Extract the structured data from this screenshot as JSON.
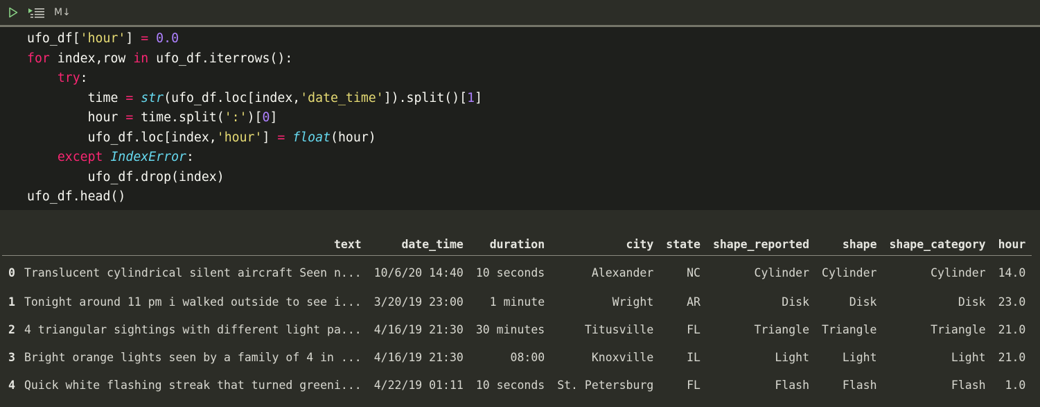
{
  "toolbar": {
    "run_icon": "play-icon",
    "run_below_icon": "run-below-icon",
    "markdown_label": "M↓"
  },
  "code": {
    "lines": [
      "ufo_df['hour'] = 0.0",
      "for index,row in ufo_df.iterrows():",
      "    try:",
      "        time = str(ufo_df.loc[index,'date_time']).split()[1]",
      "        hour = time.split(':')[0]",
      "        ufo_df.loc[index,'hour'] = float(hour)",
      "    except IndexError:",
      "        ufo_df.drop(index)",
      "ufo_df.head()"
    ]
  },
  "colors": {
    "keyword": "#f92672",
    "string": "#e6db74",
    "number": "#ae81ff",
    "builtin": "#66d9ef",
    "code_bg": "#1e1f1c",
    "output_bg": "#2c2d27"
  },
  "output": {
    "columns": [
      "",
      "text",
      "date_time",
      "duration",
      "city",
      "state",
      "shape_reported",
      "shape",
      "shape_category",
      "hour"
    ],
    "rows": [
      [
        "0",
        "Translucent cylindrical silent aircraft Seen n...",
        "10/6/20 14:40",
        "10 seconds",
        "Alexander",
        "NC",
        "Cylinder",
        "Cylinder",
        "Cylinder",
        "14.0"
      ],
      [
        "1",
        "Tonight around 11 pm i walked outside to see i...",
        "3/20/19 23:00",
        "1 minute",
        "Wright",
        "AR",
        "Disk",
        "Disk",
        "Disk",
        "23.0"
      ],
      [
        "2",
        "4 triangular sightings with different light pa...",
        "4/16/19 21:30",
        "30 minutes",
        "Titusville",
        "FL",
        "Triangle",
        "Triangle",
        "Triangle",
        "21.0"
      ],
      [
        "3",
        "Bright orange lights seen by a family of 4 in ...",
        "4/16/19 21:30",
        "08:00",
        "Knoxville",
        "IL",
        "Light",
        "Light",
        "Light",
        "21.0"
      ],
      [
        "4",
        "Quick white flashing streak that turned greeni...",
        "4/22/19 01:11",
        "10 seconds",
        "St. Petersburg",
        "FL",
        "Flash",
        "Flash",
        "Flash",
        "1.0"
      ]
    ]
  }
}
